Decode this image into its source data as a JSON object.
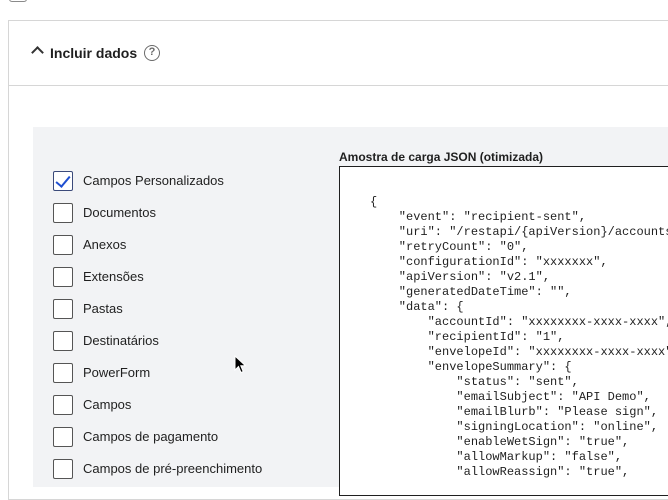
{
  "section": {
    "title": "Incluir dados",
    "help_icon": "?"
  },
  "checkboxes": [
    {
      "label": "Campos Personalizados",
      "checked": true
    },
    {
      "label": "Documentos",
      "checked": false
    },
    {
      "label": "Anexos",
      "checked": false
    },
    {
      "label": "Extensões",
      "checked": false
    },
    {
      "label": "Pastas",
      "checked": false
    },
    {
      "label": "Destinatários",
      "checked": false
    },
    {
      "label": "PowerForm",
      "checked": false
    },
    {
      "label": "Campos",
      "checked": false
    },
    {
      "label": "Campos de pagamento",
      "checked": false
    },
    {
      "label": "Campos de pré-preenchimento",
      "checked": false
    }
  ],
  "json_sample": {
    "title": "Amostra de carga JSON (otimizada)",
    "code": "{\n    \"event\": \"recipient-sent\",\n    \"uri\": \"/restapi/{apiVersion}/accounts/\",\n    \"retryCount\": \"0\",\n    \"configurationId\": \"xxxxxxx\",\n    \"apiVersion\": \"v2.1\",\n    \"generatedDateTime\": \"\",\n    \"data\": {\n        \"accountId\": \"xxxxxxxx-xxxx-xxxx\",\n        \"recipientId\": \"1\",\n        \"envelopeId\": \"xxxxxxxx-xxxx-xxxx\",\n        \"envelopeSummary\": {\n            \"status\": \"sent\",\n            \"emailSubject\": \"API Demo\",\n            \"emailBlurb\": \"Please sign\",\n            \"signingLocation\": \"online\",\n            \"enableWetSign\": \"true\",\n            \"allowMarkup\": \"false\",\n            \"allowReassign\": \"true\","
  },
  "colors": {
    "check_accent": "#1f4fd1",
    "content_bg": "#f2f3f5",
    "border": "#d6d6d6"
  }
}
